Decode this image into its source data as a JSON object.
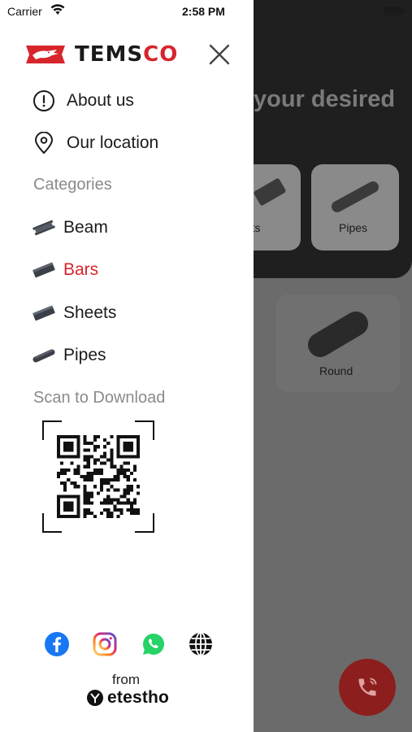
{
  "status_bar": {
    "carrier": "Carrier",
    "time": "2:58 PM"
  },
  "background": {
    "title_fragment": "your desired",
    "cards": [
      {
        "label": "eets"
      },
      {
        "label": "Pipes"
      },
      {
        "label": "Round"
      }
    ],
    "call_icon": "phone-call-icon"
  },
  "drawer": {
    "brand": {
      "part1": "TEMS",
      "part2": "CO",
      "logo_icon": "temsco-crocodile-logo"
    },
    "close_icon": "close-icon",
    "menu": [
      {
        "label": "About us",
        "icon": "info-circle-icon"
      },
      {
        "label": "Our location",
        "icon": "location-pin-icon"
      }
    ],
    "categories_title": "Categories",
    "categories": [
      {
        "label": "Beam",
        "icon": "beam-icon",
        "active": false
      },
      {
        "label": "Bars",
        "icon": "bar-icon",
        "active": true
      },
      {
        "label": "Sheets",
        "icon": "sheet-icon",
        "active": false
      },
      {
        "label": "Pipes",
        "icon": "pipe-icon",
        "active": false
      }
    ],
    "scan_title": "Scan to Download",
    "social": [
      {
        "name": "facebook-icon",
        "color": "#1877f2"
      },
      {
        "name": "instagram-icon",
        "color": "#d62976"
      },
      {
        "name": "whatsapp-icon",
        "color": "#25d366"
      },
      {
        "name": "globe-icon",
        "color": "#111111"
      }
    ],
    "footer": {
      "from": "from",
      "maker": "etestho"
    },
    "accent_color": "#d6252b"
  }
}
